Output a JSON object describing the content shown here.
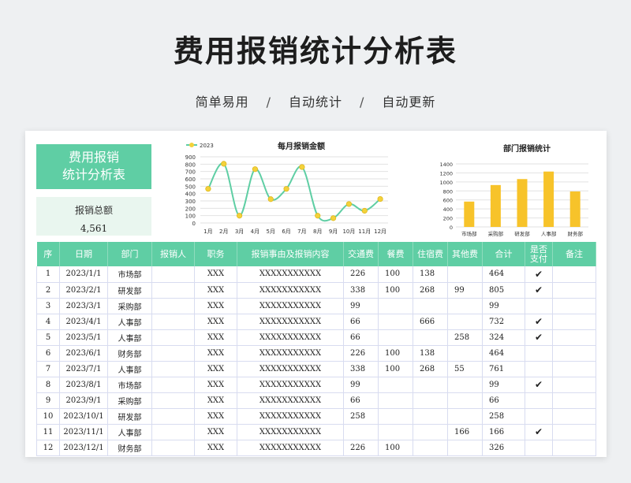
{
  "header": {
    "title": "费用报销统计分析表",
    "tags": [
      "简单易用",
      "自动统计",
      "自动更新"
    ],
    "separator": "/"
  },
  "summary": {
    "hero_line1": "费用报销",
    "hero_line2": "统计分析表",
    "total_label": "报销总额",
    "total_value": "4,561"
  },
  "chart_data": [
    {
      "type": "line",
      "title": "每月报销金额",
      "legend": "top-left",
      "categories": [
        "1月",
        "2月",
        "3月",
        "4月",
        "5月",
        "6月",
        "7月",
        "8月",
        "9月",
        "10月",
        "11月",
        "12月"
      ],
      "series": [
        {
          "name": "2023",
          "values": [
            464,
            805,
            99,
            732,
            324,
            464,
            761,
            99,
            66,
            258,
            166,
            326
          ]
        }
      ],
      "ylim": [
        0,
        900
      ],
      "yticks": [
        0,
        100,
        200,
        300,
        400,
        500,
        600,
        700,
        800,
        900
      ],
      "grid": true,
      "colors": {
        "line": "#5fcea4",
        "marker": "#f3d23b"
      }
    },
    {
      "type": "bar",
      "title": "部门报销统计",
      "categories": [
        "市场部",
        "采购部",
        "研发部",
        "人事部",
        "财务部"
      ],
      "values": [
        563,
        930,
        1063,
        1230,
        788
      ],
      "ylim": [
        0,
        1400
      ],
      "yticks": [
        0,
        200,
        400,
        600,
        800,
        1000,
        1200,
        1400
      ],
      "grid": true,
      "colors": {
        "bar": "#f7c32a"
      }
    }
  ],
  "table": {
    "columns": [
      "序",
      "日期",
      "部门",
      "报销人",
      "职务",
      "报销事由及报销内容",
      "交通费",
      "餐费",
      "住宿费",
      "其他费",
      "合计",
      "是否支付",
      "备注"
    ],
    "rows": [
      {
        "no": "1",
        "date": "2023/1/1",
        "dept": "市场部",
        "person": "",
        "position": "XXX",
        "reason": "XXXXXXXXXXX",
        "transport": "226",
        "meal": "100",
        "lodging": "138",
        "other": "",
        "total": "464",
        "paid": "✔",
        "note": ""
      },
      {
        "no": "2",
        "date": "2023/2/1",
        "dept": "研发部",
        "person": "",
        "position": "XXX",
        "reason": "XXXXXXXXXXX",
        "transport": "338",
        "meal": "100",
        "lodging": "268",
        "other": "99",
        "total": "805",
        "paid": "✔",
        "note": ""
      },
      {
        "no": "3",
        "date": "2023/3/1",
        "dept": "采购部",
        "person": "",
        "position": "XXX",
        "reason": "XXXXXXXXXXX",
        "transport": "99",
        "meal": "",
        "lodging": "",
        "other": "",
        "total": "99",
        "paid": "",
        "note": ""
      },
      {
        "no": "4",
        "date": "2023/4/1",
        "dept": "人事部",
        "person": "",
        "position": "XXX",
        "reason": "XXXXXXXXXXX",
        "transport": "66",
        "meal": "",
        "lodging": "666",
        "other": "",
        "total": "732",
        "paid": "✔",
        "note": ""
      },
      {
        "no": "5",
        "date": "2023/5/1",
        "dept": "人事部",
        "person": "",
        "position": "XXX",
        "reason": "XXXXXXXXXXX",
        "transport": "66",
        "meal": "",
        "lodging": "",
        "other": "258",
        "total": "324",
        "paid": "✔",
        "note": ""
      },
      {
        "no": "6",
        "date": "2023/6/1",
        "dept": "财务部",
        "person": "",
        "position": "XXX",
        "reason": "XXXXXXXXXXX",
        "transport": "226",
        "meal": "100",
        "lodging": "138",
        "other": "",
        "total": "464",
        "paid": "",
        "note": ""
      },
      {
        "no": "7",
        "date": "2023/7/1",
        "dept": "人事部",
        "person": "",
        "position": "XXX",
        "reason": "XXXXXXXXXXX",
        "transport": "338",
        "meal": "100",
        "lodging": "268",
        "other": "55",
        "total": "761",
        "paid": "",
        "note": ""
      },
      {
        "no": "8",
        "date": "2023/8/1",
        "dept": "市场部",
        "person": "",
        "position": "XXX",
        "reason": "XXXXXXXXXXX",
        "transport": "99",
        "meal": "",
        "lodging": "",
        "other": "",
        "total": "99",
        "paid": "✔",
        "note": ""
      },
      {
        "no": "9",
        "date": "2023/9/1",
        "dept": "采购部",
        "person": "",
        "position": "XXX",
        "reason": "XXXXXXXXXXX",
        "transport": "66",
        "meal": "",
        "lodging": "",
        "other": "",
        "total": "66",
        "paid": "",
        "note": ""
      },
      {
        "no": "10",
        "date": "2023/10/1",
        "dept": "研发部",
        "person": "",
        "position": "XXX",
        "reason": "XXXXXXXXXXX",
        "transport": "258",
        "meal": "",
        "lodging": "",
        "other": "",
        "total": "258",
        "paid": "",
        "note": ""
      },
      {
        "no": "11",
        "date": "2023/11/1",
        "dept": "人事部",
        "person": "",
        "position": "XXX",
        "reason": "XXXXXXXXXXX",
        "transport": "",
        "meal": "",
        "lodging": "",
        "other": "166",
        "total": "166",
        "paid": "✔",
        "note": ""
      },
      {
        "no": "12",
        "date": "2023/12/1",
        "dept": "财务部",
        "person": "",
        "position": "XXX",
        "reason": "XXXXXXXXXXX",
        "transport": "226",
        "meal": "100",
        "lodging": "",
        "other": "",
        "total": "326",
        "paid": "",
        "note": ""
      }
    ]
  }
}
